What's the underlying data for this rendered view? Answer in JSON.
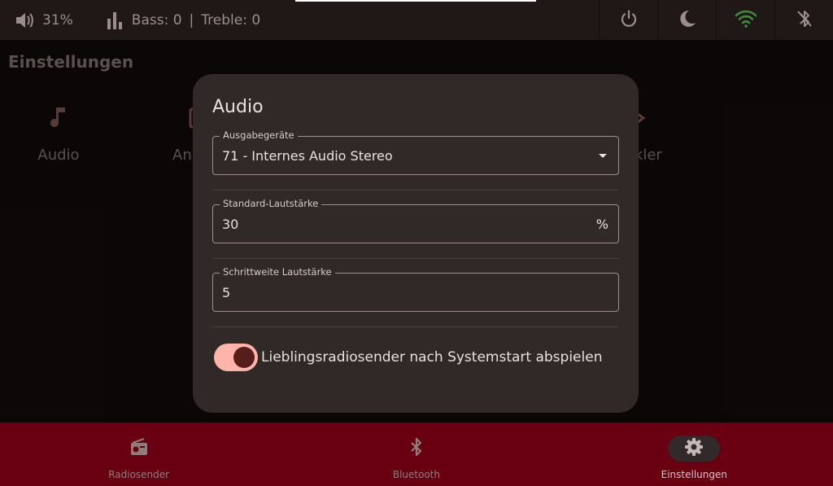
{
  "status": {
    "volume": "31%",
    "bass": "Bass: 0",
    "separator": "|",
    "treble": "Treble: 0"
  },
  "page": {
    "title": "Einstellungen",
    "tiles": [
      {
        "label": "Audio",
        "icon": "music-note-icon"
      },
      {
        "label": "An",
        "icon": "display-icon"
      },
      {
        "label": "ckler",
        "icon": "developer-icon"
      }
    ]
  },
  "dialog": {
    "title": "Audio",
    "output": {
      "label": "Ausgabegeräte",
      "value": "71 - Internes Audio Stereo"
    },
    "default_volume": {
      "label": "Standard-Lautstärke",
      "value": "30",
      "suffix": "%"
    },
    "step_volume": {
      "label": "Schrittweite Lautstärke",
      "value": "5"
    },
    "autoplay": {
      "label": "Lieblingsradiosender nach Systemstart abspielen",
      "on": true
    }
  },
  "nav": {
    "items": [
      {
        "label": "Radiosender",
        "icon": "radio-icon"
      },
      {
        "label": "Bluetooth",
        "icon": "bluetooth-icon"
      },
      {
        "label": "Einstellungen",
        "icon": "settings-gear-icon",
        "active": true
      }
    ]
  },
  "colors": {
    "accent": "#ffb4ab",
    "navbar": "#690012",
    "wifi": "#3c8c3c"
  }
}
